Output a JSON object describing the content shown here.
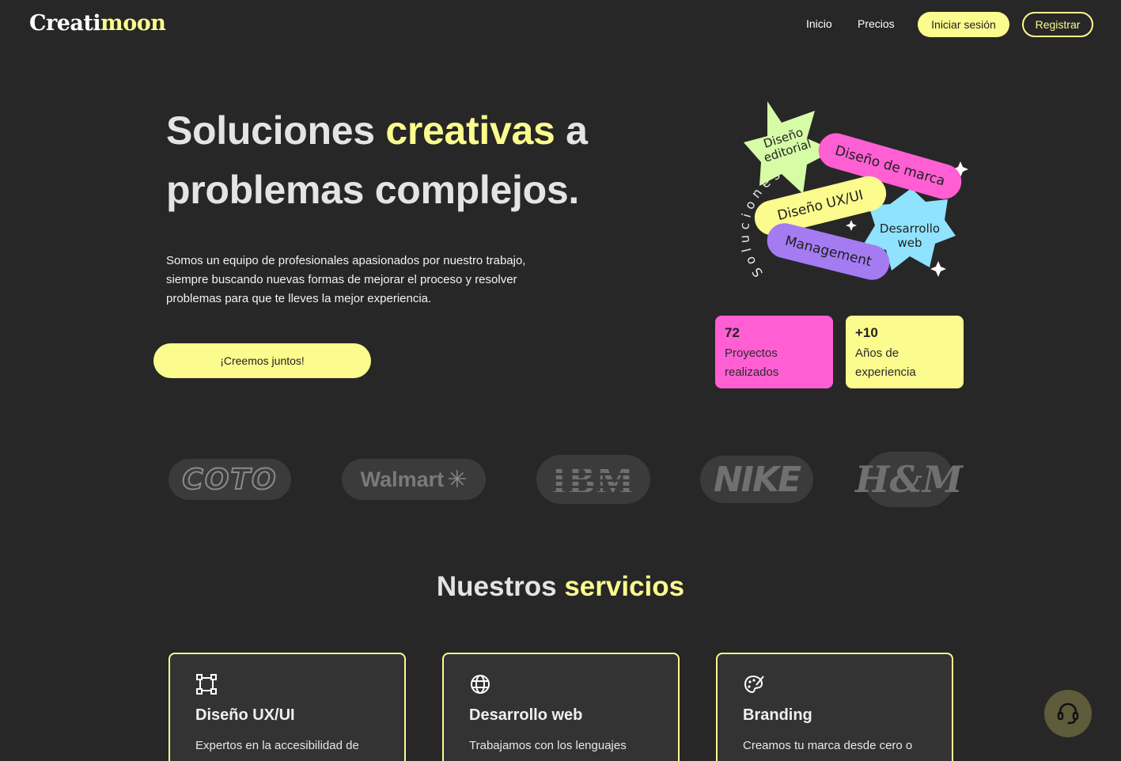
{
  "nav": {
    "logo_part1": "Creati",
    "logo_part2": "moon",
    "links": [
      "Inicio",
      "Precios"
    ],
    "login": "Iniciar sesión",
    "register": "Registrar"
  },
  "hero": {
    "title_1": "Soluciones ",
    "title_highlight": "creativas",
    "title_2": " a problemas complejos.",
    "description": "Somos un equipo de profesionales apasionados por nuestro trabajo, siempre buscando nuevas formas de mejorar el proceso y resolver problemas para que te lleves la mejor experiencia.",
    "cta": "¡Creemos juntos!"
  },
  "illustration": {
    "curved_text": "Soluciones creativas",
    "tags": [
      "Diseño editorial",
      "Diseño de marca",
      "Diseño UX/UI",
      "Desarrollo web",
      "Management"
    ],
    "tag_editorial_line1": "Diseño",
    "tag_editorial_line2": "editorial",
    "tag_web_line1": "Desarrollo",
    "tag_web_line2": "web"
  },
  "stats": [
    {
      "number": "72",
      "label": "Proyectos realizados",
      "color": "#ff5fd2"
    },
    {
      "number": "+10",
      "label": "Años de experiencia",
      "color": "#fbfb8e"
    }
  ],
  "clients": [
    "COTO",
    "Walmart",
    "IBM",
    "NIKE",
    "H&M"
  ],
  "services": {
    "title_1": "Nuestros ",
    "title_highlight": "servicios",
    "cards": [
      {
        "icon": "frame-icon",
        "title": "Diseño UX/UI",
        "desc": "Expertos en la accesibilidad de"
      },
      {
        "icon": "globe-icon",
        "title": "Desarrollo web",
        "desc": "Trabajamos con los lenguajes"
      },
      {
        "icon": "palette-icon",
        "title": "Branding",
        "desc": "Creamos tu marca desde cero o"
      }
    ]
  },
  "colors": {
    "accent": "#fbfb8e",
    "pink": "#ff5fd2",
    "background": "#272727",
    "green": "#d6fca6",
    "blue": "#8fe3ff",
    "purple": "#a57bf2"
  }
}
